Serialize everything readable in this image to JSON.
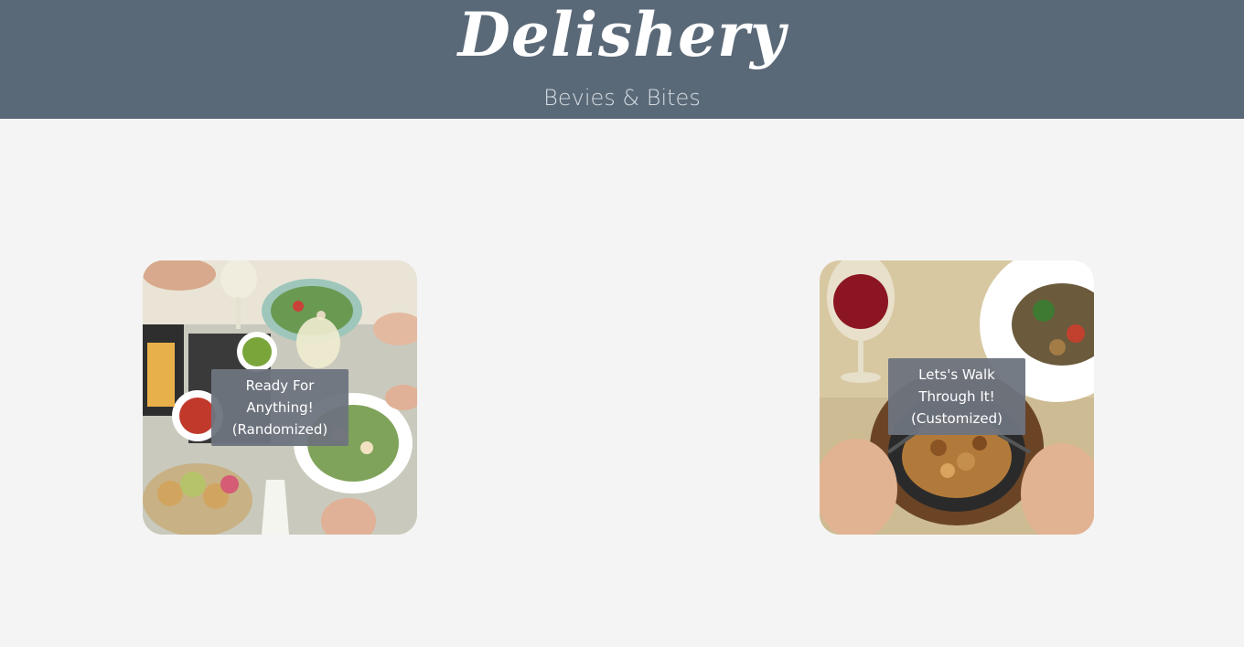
{
  "header": {
    "brand": "Delishery",
    "tagline": "Bevies & Bites"
  },
  "cards": [
    {
      "line1": "Ready For",
      "line2": "Anything!",
      "line3": "(Randomized)",
      "image_icon": "dining-table-photo"
    },
    {
      "line1": "Lets's Walk",
      "line2": "Through It!",
      "line3": "(Customized)",
      "image_icon": "wine-and-stir-fry-photo"
    }
  ],
  "colors": {
    "header_bg": "#5a6978",
    "page_bg": "#f4f4f4",
    "label_bg": "#6e747e"
  }
}
